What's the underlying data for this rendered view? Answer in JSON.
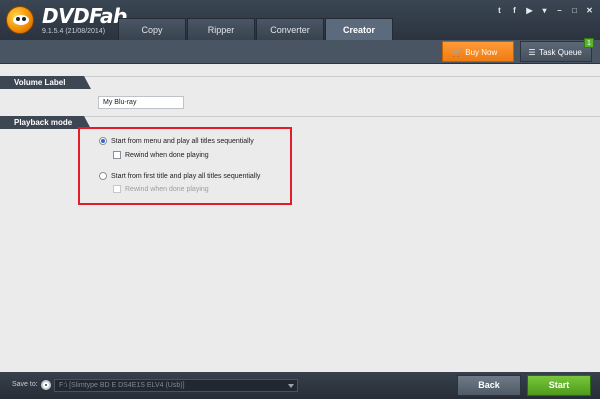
{
  "app": {
    "name": "DVDFab",
    "version": "9.1.5.4 (21/08/2014)"
  },
  "tabs": [
    {
      "label": "Copy",
      "active": false
    },
    {
      "label": "Ripper",
      "active": false
    },
    {
      "label": "Converter",
      "active": false
    },
    {
      "label": "Creator",
      "active": true
    }
  ],
  "header_icons": [
    "twitter-icon",
    "facebook-icon",
    "youtube-icon",
    "settings-icon",
    "minimize-icon",
    "restore-icon",
    "close-icon"
  ],
  "toolbar": {
    "buy_label": "Buy Now",
    "task_queue_label": "Task Queue",
    "task_queue_count": "1"
  },
  "volume_label": {
    "title": "Volume Label",
    "value": "My Blu-ray"
  },
  "playback_mode": {
    "title": "Playback mode",
    "option1": {
      "label": "Start from menu and play all titles sequentially",
      "selected": true
    },
    "option1_rewind": {
      "label": "Rewind when done playing",
      "checked": false,
      "enabled": true
    },
    "option2": {
      "label": "Start from first title and play all titles sequentially",
      "selected": false
    },
    "option2_rewind": {
      "label": "Rewind when done playing",
      "checked": false,
      "enabled": false
    }
  },
  "footer": {
    "save_to_label": "Save to:",
    "destination": "F:\\ [Slimtype BD  E  DS4E1S ELV4 (Usb)]",
    "back_label": "Back",
    "start_label": "Start"
  },
  "colors": {
    "accent_orange": "#f08a1c",
    "start_green": "#5fb02a",
    "highlight_red": "#e01d2a",
    "header_dark": "#2f3945"
  }
}
